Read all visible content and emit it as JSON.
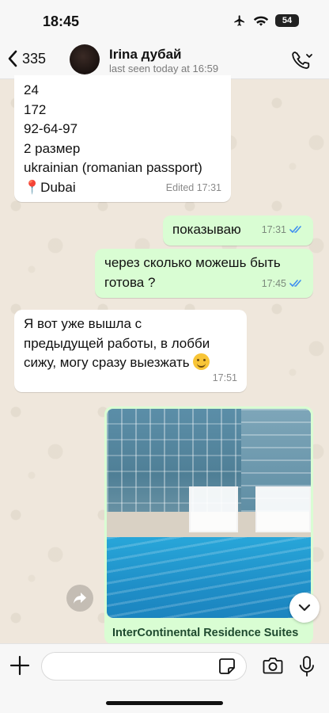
{
  "status_bar": {
    "time": "18:45",
    "battery": "54"
  },
  "header": {
    "back_count": "335",
    "contact_name": "Irina дубай",
    "last_seen": "last seen today at 16:59"
  },
  "messages": [
    {
      "direction": "in",
      "lines": [
        "24",
        "172",
        "92-64-97",
        "2 размер",
        "ukrainian (romanian passport)",
        "Dubai"
      ],
      "pin_icon": "round-pushpin-icon",
      "meta": "Edited 17:31"
    },
    {
      "direction": "out",
      "text": "показываю",
      "time": "17:31",
      "status": "read"
    },
    {
      "direction": "out",
      "lines": [
        "через сколько можешь быть",
        "готова ?"
      ],
      "time": "17:45",
      "status": "read"
    },
    {
      "direction": "in",
      "lines": [
        "Я вот уже вышла с",
        "предыдущей работы, в лобби",
        "сижу, могу сразу выезжать"
      ],
      "emoji": "smiling-face-icon",
      "time": "17:51"
    },
    {
      "direction": "out",
      "type": "link-preview",
      "title": "InterContinental Residence Suites"
    }
  ],
  "input": {
    "placeholder": ""
  },
  "colors": {
    "outgoing_bubble": "#d9fdd3",
    "incoming_bubble": "#ffffff",
    "read_ticks": "#3f8ef0",
    "background": "#efeae2"
  }
}
